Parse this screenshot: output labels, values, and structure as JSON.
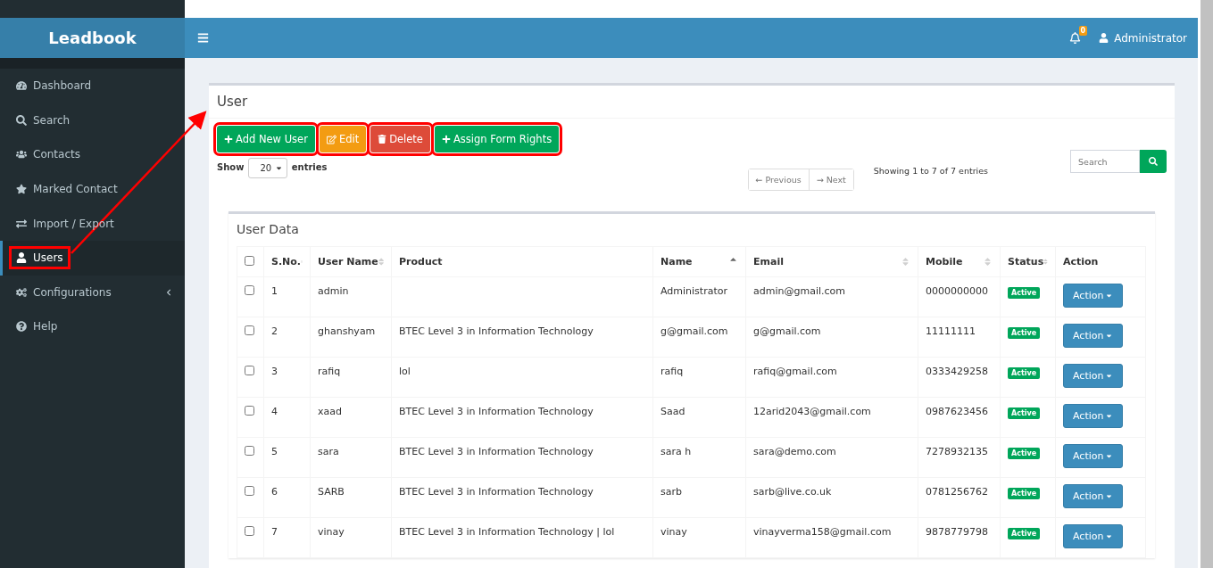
{
  "brand": "Leadbook",
  "header": {
    "notification_count": "0",
    "user": "Administrator"
  },
  "sidebar": {
    "items": [
      {
        "label": "Dashboard",
        "selected": false,
        "annotated": false
      },
      {
        "label": "Search",
        "selected": false,
        "annotated": false
      },
      {
        "label": "Contacts",
        "selected": false,
        "annotated": false
      },
      {
        "label": "Marked Contact",
        "selected": false,
        "annotated": false
      },
      {
        "label": "Import / Export",
        "selected": false,
        "annotated": false
      },
      {
        "label": "Users",
        "selected": true,
        "annotated": true
      },
      {
        "label": "Configurations",
        "selected": false,
        "annotated": false,
        "expandable": true
      },
      {
        "label": "Help",
        "selected": false,
        "annotated": false
      }
    ]
  },
  "panel": {
    "title": "User",
    "buttons": [
      {
        "label": "Add New User",
        "kind": "add",
        "annotated": true
      },
      {
        "label": "Edit",
        "kind": "edit",
        "annotated": true
      },
      {
        "label": "Delete",
        "kind": "delete",
        "annotated": true
      },
      {
        "label": "Assign Form Rights",
        "kind": "add",
        "annotated": true
      }
    ],
    "length": {
      "before": "Show",
      "value": "20",
      "after": "entries"
    },
    "pagination": {
      "previous": "← Previous",
      "next": "→ Next"
    },
    "info": "Showing 1 to 7 of 7 entries",
    "search": {
      "placeholder": "Search"
    }
  },
  "table": {
    "title": "User Data",
    "columns": [
      {
        "label": "S.No.",
        "sortable": true,
        "sorted": false
      },
      {
        "label": "User Name",
        "sortable": true,
        "sorted": false
      },
      {
        "label": "Product",
        "sortable": false,
        "sorted": false
      },
      {
        "label": "Name",
        "sortable": true,
        "sorted": true
      },
      {
        "label": "Email",
        "sortable": true,
        "sorted": false
      },
      {
        "label": "Mobile",
        "sortable": true,
        "sorted": false
      },
      {
        "label": "Status",
        "sortable": true,
        "sorted": false
      },
      {
        "label": "Action",
        "sortable": false,
        "sorted": false
      }
    ],
    "select_all": {
      "checked": false
    },
    "rows": [
      {
        "checked": false,
        "sno": "1",
        "username": "admin",
        "product": "",
        "name": "Administrator",
        "email": "admin@gmail.com",
        "mobile": "0000000000",
        "status": "Active",
        "action": "Action"
      },
      {
        "checked": false,
        "sno": "2",
        "username": "ghanshyam",
        "product": "BTEC Level 3 in Information Technology",
        "name": "g@gmail.com",
        "email": "g@gmail.com",
        "mobile": "11111111",
        "status": "Active",
        "action": "Action"
      },
      {
        "checked": false,
        "sno": "3",
        "username": "rafiq",
        "product": "lol",
        "name": "rafiq",
        "email": "rafiq@gmail.com",
        "mobile": "0333429258",
        "status": "Active",
        "action": "Action"
      },
      {
        "checked": false,
        "sno": "4",
        "username": "xaad",
        "product": "BTEC Level 3 in Information Technology",
        "name": "Saad",
        "email": "12arid2043@gmail.com",
        "mobile": "0987623456",
        "status": "Active",
        "action": "Action"
      },
      {
        "checked": false,
        "sno": "5",
        "username": "sara",
        "product": "BTEC Level 3 in Information Technology",
        "name": "sara h",
        "email": "sara@demo.com",
        "mobile": "7278932135",
        "status": "Active",
        "action": "Action"
      },
      {
        "checked": false,
        "sno": "6",
        "username": "SARB",
        "product": "BTEC Level 3 in Information Technology",
        "name": "sarb",
        "email": "sarb@live.co.uk",
        "mobile": "0781256762",
        "status": "Active",
        "action": "Action"
      },
      {
        "checked": false,
        "sno": "7",
        "username": "vinay",
        "product": "BTEC Level 3 in Information Technology | lol",
        "name": "vinay",
        "email": "vinayverma158@gmail.com",
        "mobile": "9878779798",
        "status": "Active",
        "action": "Action"
      }
    ]
  }
}
